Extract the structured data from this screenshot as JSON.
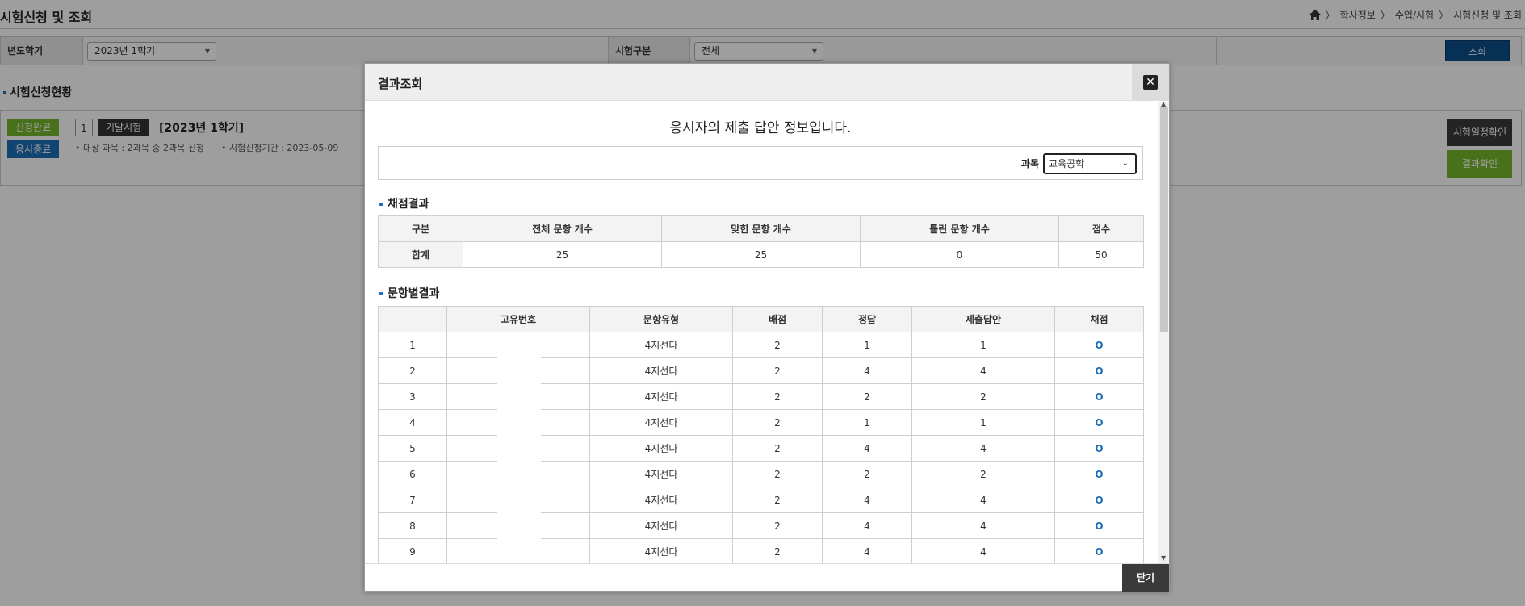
{
  "page": {
    "title": "시험신청 및 조회",
    "breadcrumb": [
      "학사정보",
      "수업/시험",
      "시험신청 및 조회"
    ]
  },
  "search": {
    "year_label": "년도학기",
    "year_value": "2023년 1학기",
    "type_label": "시험구분",
    "type_value": "전체",
    "search_button": "조회"
  },
  "status_section": {
    "title": "시험신청현황",
    "badge_applied": "신청완료",
    "badge_ended": "응시종료",
    "number": "1",
    "exam_type": "기말시험",
    "term": "[2023년 1학기]",
    "target_courses": "• 대상 과목 : 2과목 중 2과목 신청",
    "apply_period": "• 시험신청기간 : 2023-05-09",
    "schedule_button": "시험일정확인",
    "result_button": "결과확인"
  },
  "modal": {
    "title": "결과조회",
    "notice": "응시자의 제출 답안 정보입니다.",
    "subject_label": "과목",
    "subject_value": "교육공학",
    "close_button": "닫기",
    "grading": {
      "title": "채점결과",
      "headers": [
        "구분",
        "전체 문항 개수",
        "맞힌 문항 개수",
        "틀린 문항 개수",
        "점수"
      ],
      "row": {
        "label": "합계",
        "total": "25",
        "correct": "25",
        "wrong": "0",
        "score": "50"
      }
    },
    "questions": {
      "title": "문항별결과",
      "headers": [
        "",
        "고유번호",
        "문항유형",
        "배점",
        "정답",
        "제출답안",
        "채점"
      ],
      "rows": [
        {
          "no": "1",
          "uid": "",
          "type": "4지선다",
          "points": "2",
          "answer": "1",
          "submitted": "1",
          "mark": "O"
        },
        {
          "no": "2",
          "uid": "",
          "type": "4지선다",
          "points": "2",
          "answer": "4",
          "submitted": "4",
          "mark": "O"
        },
        {
          "no": "3",
          "uid": "",
          "type": "4지선다",
          "points": "2",
          "answer": "2",
          "submitted": "2",
          "mark": "O"
        },
        {
          "no": "4",
          "uid": "",
          "type": "4지선다",
          "points": "2",
          "answer": "1",
          "submitted": "1",
          "mark": "O"
        },
        {
          "no": "5",
          "uid": "",
          "type": "4지선다",
          "points": "2",
          "answer": "4",
          "submitted": "4",
          "mark": "O"
        },
        {
          "no": "6",
          "uid": "",
          "type": "4지선다",
          "points": "2",
          "answer": "2",
          "submitted": "2",
          "mark": "O"
        },
        {
          "no": "7",
          "uid": "",
          "type": "4지선다",
          "points": "2",
          "answer": "4",
          "submitted": "4",
          "mark": "O"
        },
        {
          "no": "8",
          "uid": "",
          "type": "4지선다",
          "points": "2",
          "answer": "4",
          "submitted": "4",
          "mark": "O"
        },
        {
          "no": "9",
          "uid": "",
          "type": "4지선다",
          "points": "2",
          "answer": "4",
          "submitted": "4",
          "mark": "O"
        }
      ]
    }
  },
  "colors": {
    "primary": "#0b4f8a",
    "green": "#77b52a",
    "dark": "#3a3a3a",
    "mark": "#1e6eb6"
  }
}
